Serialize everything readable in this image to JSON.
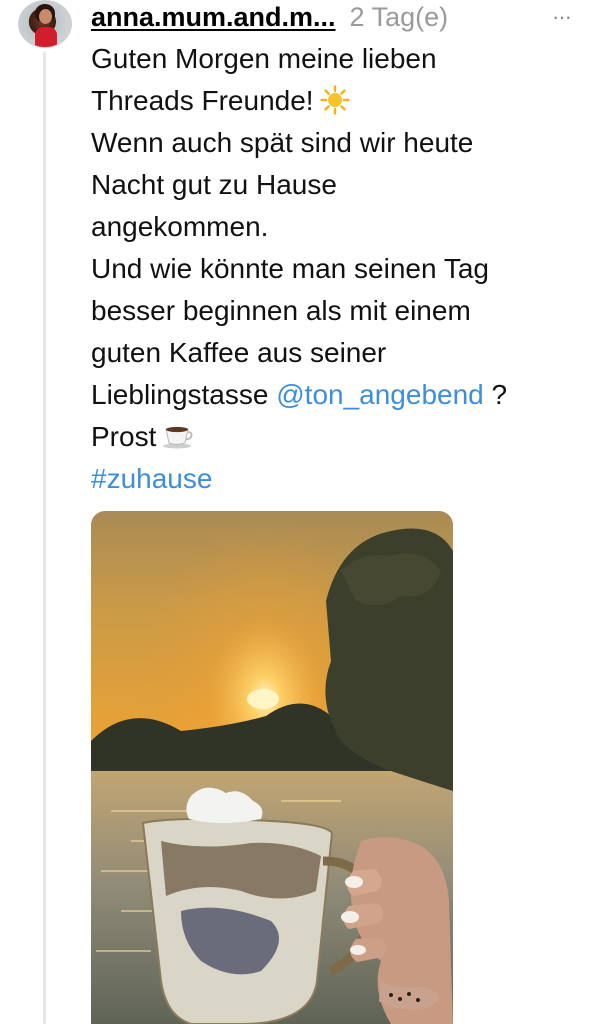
{
  "post": {
    "username": "anna.mum.and.m...",
    "time": "2 Tag(e)",
    "more": "···",
    "lines": [
      {
        "text": "Guten Morgen meine lieben"
      },
      {
        "text": "Threads Freunde!"
      },
      {
        "text": "Wenn auch spät sind wir heute"
      },
      {
        "text": "Nacht gut zu Hause"
      },
      {
        "text": "angekommen."
      },
      {
        "text": "Und wie könnte man seinen Tag"
      },
      {
        "text": "besser beginnen als mit einem"
      },
      {
        "text": "guten Kaffee aus seiner"
      },
      {
        "text": "Lieblingstasse"
      },
      {
        "text": "Prost"
      }
    ],
    "mention": "@ton_angebend",
    "mention_suffix": "?",
    "hashtag": "#zuhause",
    "icons": {
      "sun": "sun-emoji-icon",
      "coffee": "coffee-cup-emoji-icon",
      "more": "more-options-icon"
    }
  },
  "colors": {
    "link": "#3d8edb",
    "muted": "#9a9a9a",
    "thread_line": "#e6e6e6"
  }
}
